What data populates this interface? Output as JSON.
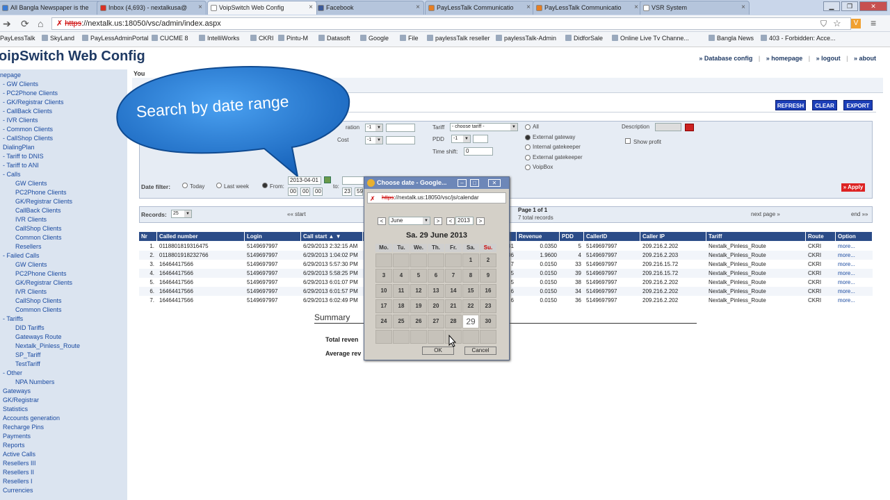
{
  "browser": {
    "tabs": [
      {
        "title": "All Bangla Newspaper is the",
        "color": "#3a7bd5"
      },
      {
        "title": "Inbox (4,693) - nextalkusa@",
        "color": "#d93025"
      },
      {
        "title": "VoipSwitch Web Config",
        "color": "#ffffff"
      },
      {
        "title": "Facebook",
        "color": "#3b5998"
      },
      {
        "title": "PayLessTalk Communicatio",
        "color": "#e67e22"
      },
      {
        "title": "PayLessTalk Communicatio",
        "color": "#e67e22"
      },
      {
        "title": "VSR System",
        "color": "#ffffff"
      }
    ],
    "url_proto": "https",
    "url_rest": "://nextalk.us:18050/vsc/admin/index.aspx",
    "bookmarks": [
      "PayLessTalk",
      "SkyLand",
      "PayLessAdminPortal",
      "CUCME 8",
      "IntelliWorks",
      "CKRI",
      "Pintu-M",
      "Datasoft",
      "Google",
      "File",
      "paylessTalk reseller",
      "paylessTalk-Admin",
      "DidforSale",
      "Online Live Tv Channe...",
      "Bangla News",
      "403 - Forbidden: Acce..."
    ]
  },
  "header": {
    "title": "oipSwitch Web Config",
    "links": [
      "» Database config",
      "» homepage",
      "» logout",
      "» about"
    ]
  },
  "sidebar": [
    {
      "label": "nepage",
      "indent": 0
    },
    {
      "label": "- GW Clients",
      "indent": 1
    },
    {
      "label": "- PC2Phone Clients",
      "indent": 1
    },
    {
      "label": "- GK/Registrar Clients",
      "indent": 1
    },
    {
      "label": "- CallBack Clients",
      "indent": 1
    },
    {
      "label": "- IVR Clients",
      "indent": 1
    },
    {
      "label": "- Common Clients",
      "indent": 1
    },
    {
      "label": "- CallShop Clients",
      "indent": 1
    },
    {
      "label": "DialingPlan",
      "indent": 1
    },
    {
      "label": "- Tariff to DNIS",
      "indent": 1
    },
    {
      "label": "- Tariff to ANI",
      "indent": 1
    },
    {
      "label": "- Calls",
      "indent": 1
    },
    {
      "label": "GW Clients",
      "indent": 2
    },
    {
      "label": "PC2Phone Clients",
      "indent": 2
    },
    {
      "label": "GK/Registrar Clients",
      "indent": 2
    },
    {
      "label": "CallBack Clients",
      "indent": 2
    },
    {
      "label": "IVR Clients",
      "indent": 2
    },
    {
      "label": "CallShop Clients",
      "indent": 2
    },
    {
      "label": "Common Clients",
      "indent": 2
    },
    {
      "label": "Resellers",
      "indent": 2
    },
    {
      "label": "- Failed Calls",
      "indent": 1
    },
    {
      "label": "GW Clients",
      "indent": 2
    },
    {
      "label": "PC2Phone Clients",
      "indent": 2
    },
    {
      "label": "GK/Registrar Clients",
      "indent": 2
    },
    {
      "label": "IVR Clients",
      "indent": 2
    },
    {
      "label": "CallShop Clients",
      "indent": 2
    },
    {
      "label": "Common Clients",
      "indent": 2
    },
    {
      "label": "- Tariffs",
      "indent": 1
    },
    {
      "label": "DID Tariffs",
      "indent": 2
    },
    {
      "label": "Gateways Route",
      "indent": 2
    },
    {
      "label": "Nextalk_Pinless_Route",
      "indent": 2
    },
    {
      "label": "SP_Tariff",
      "indent": 2
    },
    {
      "label": "TestTariff",
      "indent": 2
    },
    {
      "label": "- Other",
      "indent": 1
    },
    {
      "label": "NPA Numbers",
      "indent": 2
    },
    {
      "label": "Gateways",
      "indent": 1
    },
    {
      "label": "GK/Registrar",
      "indent": 1
    },
    {
      "label": "Statistics",
      "indent": 1
    },
    {
      "label": "Accounts generation",
      "indent": 1
    },
    {
      "label": "Recharge Pins",
      "indent": 1
    },
    {
      "label": "Payments",
      "indent": 1
    },
    {
      "label": "Reports",
      "indent": 1
    },
    {
      "label": "Active Calls",
      "indent": 1
    },
    {
      "label": "Resellers III",
      "indent": 1
    },
    {
      "label": "Resellers II",
      "indent": 1
    },
    {
      "label": "Resellers I",
      "indent": 1
    },
    {
      "label": "Currencies",
      "indent": 1
    }
  ],
  "you_label": "You",
  "buttons": {
    "refresh": "REFRESH",
    "clear": "CLEAR",
    "export": "EXPORT",
    "apply": "» Apply"
  },
  "filter": {
    "duration_label": "ration",
    "duration_value": "-1",
    "cost_label": "Cost",
    "cost_value": "-1",
    "tariff_label": "Tariff",
    "tariff_value": "- choose tariff -",
    "pdd_label": "PDD",
    "pdd_value": "-1",
    "timeshift_label": "Time shift:",
    "timeshift_value": "0",
    "radios": [
      "All",
      "External gateway",
      "Internal gatekeeper",
      "External gatekeeper",
      "VoipBox"
    ],
    "description_label": "Description",
    "show_profit": "Show profit",
    "datefilter_label": "Date filter:",
    "today": "Today",
    "lastweek": "Last week",
    "from": "From:",
    "from_date": "2013-04-01",
    "from_h": "00",
    "from_m": "00",
    "from_s": "00",
    "to": "to:",
    "to_h": "23",
    "to_m": "59"
  },
  "records": {
    "label": "Records:",
    "value": "25",
    "start": "«« start",
    "page": "Page 1 of 1",
    "total": "7 total records",
    "next": "next page »",
    "end": "end »»"
  },
  "table": {
    "headers": [
      "Nr",
      "Called number",
      "Login",
      "Call start ▲ ▼",
      "",
      "Revenue",
      "PDD",
      "CallerID",
      "Caller IP",
      "Tariff",
      "Route",
      "Option"
    ],
    "rows": [
      [
        "1.",
        "0118801819316475",
        "5149697997",
        "6/29/2013 2:32:15 AM",
        "31",
        "0.0350",
        "5",
        "5149697997",
        "209.216.2.202",
        "Nextalk_Pinless_Route",
        "CKRI",
        "more..."
      ],
      [
        "2.",
        "0118801918232766",
        "5149697997",
        "6/29/2013 1:04:02 PM",
        "06",
        "1.9600",
        "4",
        "5149697997",
        "209.216.2.203",
        "Nextalk_Pinless_Route",
        "CKRI",
        "more..."
      ],
      [
        "3.",
        "16464417566",
        "5149697997",
        "6/29/2013 5:57:30 PM",
        "7",
        "0.0150",
        "33",
        "5149697997",
        "209.216.15.72",
        "Nextalk_Pinless_Route",
        "CKRI",
        "more..."
      ],
      [
        "4.",
        "16464417566",
        "5149697997",
        "6/29/2013 5:58:25 PM",
        "5",
        "0.0150",
        "39",
        "5149697997",
        "209.216.15.72",
        "Nextalk_Pinless_Route",
        "CKRI",
        "more..."
      ],
      [
        "5.",
        "16464417566",
        "5149697997",
        "6/29/2013 6:01:07 PM",
        "5",
        "0.0150",
        "38",
        "5149697997",
        "209.216.2.202",
        "Nextalk_Pinless_Route",
        "CKRI",
        "more..."
      ],
      [
        "6.",
        "16464417566",
        "5149697997",
        "6/29/2013 6:01:57 PM",
        "6",
        "0.0150",
        "34",
        "5149697997",
        "209.216.2.202",
        "Nextalk_Pinless_Route",
        "CKRI",
        "more..."
      ],
      [
        "7.",
        "16464417566",
        "5149697997",
        "6/29/2013 6:02:49 PM",
        "6",
        "0.0150",
        "36",
        "5149697997",
        "209.216.2.202",
        "Nextalk_Pinless_Route",
        "CKRI",
        "more..."
      ]
    ]
  },
  "summary": {
    "title": "Summary",
    "total": "Total reven",
    "average": "Average rev"
  },
  "bubble": {
    "text": "Search by date range",
    "color": "#1e74c8"
  },
  "dialog": {
    "title": "Choose date - Google...",
    "url_proto": "https",
    "url_rest": "://nextalk.us:18050/vsc/js/calendar",
    "prev": "<",
    "month": "June",
    "next": ">",
    "prev_y": "<",
    "year": "2013",
    "next_y": ">",
    "heading": "Sa. 29 June 2013",
    "weekdays": [
      "Mo.",
      "Tu.",
      "We.",
      "Th.",
      "Fr.",
      "Sa.",
      "Su."
    ],
    "weeks": [
      [
        "",
        "",
        "",
        "",
        "",
        "1",
        "2"
      ],
      [
        "3",
        "4",
        "5",
        "6",
        "7",
        "8",
        "9"
      ],
      [
        "10",
        "11",
        "12",
        "13",
        "14",
        "15",
        "16"
      ],
      [
        "17",
        "18",
        "19",
        "20",
        "21",
        "22",
        "23"
      ],
      [
        "24",
        "25",
        "26",
        "27",
        "28",
        "29",
        "30"
      ],
      [
        "",
        "",
        "",
        "",
        "",
        "",
        ""
      ]
    ],
    "ok": "OK",
    "cancel": "Cancel"
  }
}
